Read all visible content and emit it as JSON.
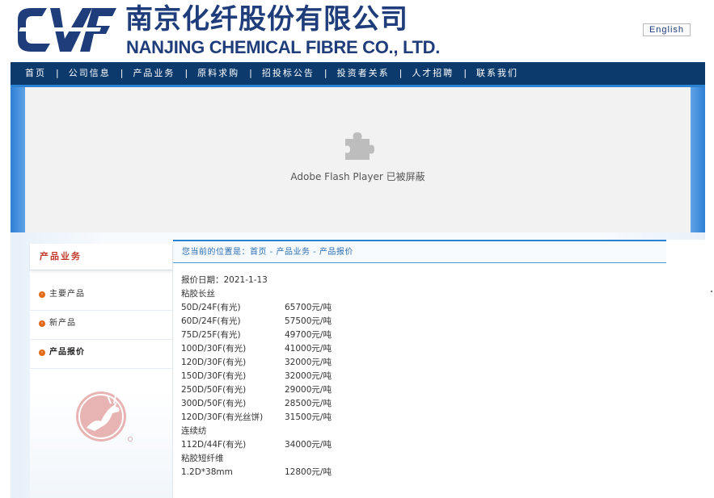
{
  "header": {
    "company_cn": "南京化纤股份有限公司",
    "company_en": "NANJING CHEMICAL FIBRE CO., LTD.",
    "english_link": "English",
    "brand_color": "#1f3d7a"
  },
  "nav": {
    "items": [
      "首页",
      "公司信息",
      "产品业务",
      "原料求购",
      "招投标公告",
      "投资者关系",
      "人才招聘",
      "联系我们"
    ],
    "separator": "|",
    "background": "#0c3a6c"
  },
  "banner": {
    "flash_message": "Adobe Flash Player 已被屏蔽",
    "icon": "puzzle-plugin-icon"
  },
  "sidebar": {
    "title": "产品业务",
    "items": [
      {
        "label": "主要产品",
        "active": false
      },
      {
        "label": "新产品",
        "active": false
      },
      {
        "label": "产品报价",
        "active": true
      }
    ]
  },
  "main": {
    "breadcrumb": "您当前的位置是：首页 - 产品业务 - 产品报价",
    "quote_date_label": "报价日期：",
    "quote_date": "2021-1-13",
    "sections": [
      {
        "title": "粘胶长丝",
        "rows": [
          {
            "spec": "50D/24F(有光)",
            "price": "65700元/吨"
          },
          {
            "spec": "60D/24F(有光)",
            "price": "57500元/吨"
          },
          {
            "spec": "75D/25F(有光)",
            "price": "49700元/吨"
          },
          {
            "spec": "100D/30F(有光)",
            "price": "41000元/吨"
          },
          {
            "spec": "120D/30F(有光)",
            "price": "32000元/吨"
          },
          {
            "spec": "150D/30F(有光)",
            "price": "32000元/吨"
          },
          {
            "spec": "250D/50F(有光)",
            "price": "29000元/吨"
          },
          {
            "spec": "300D/50F(有光)",
            "price": "28500元/吨"
          },
          {
            "spec": "120D/30F(有光丝饼)",
            "price": "31500元/吨"
          }
        ]
      },
      {
        "title": "连续纺",
        "rows": [
          {
            "spec": "112D/44F(有光)",
            "price": "34000元/吨"
          }
        ]
      },
      {
        "title": "粘胶短纤维",
        "rows": [
          {
            "spec": "1.2D*38mm",
            "price": "12800元/吨"
          }
        ]
      }
    ]
  }
}
